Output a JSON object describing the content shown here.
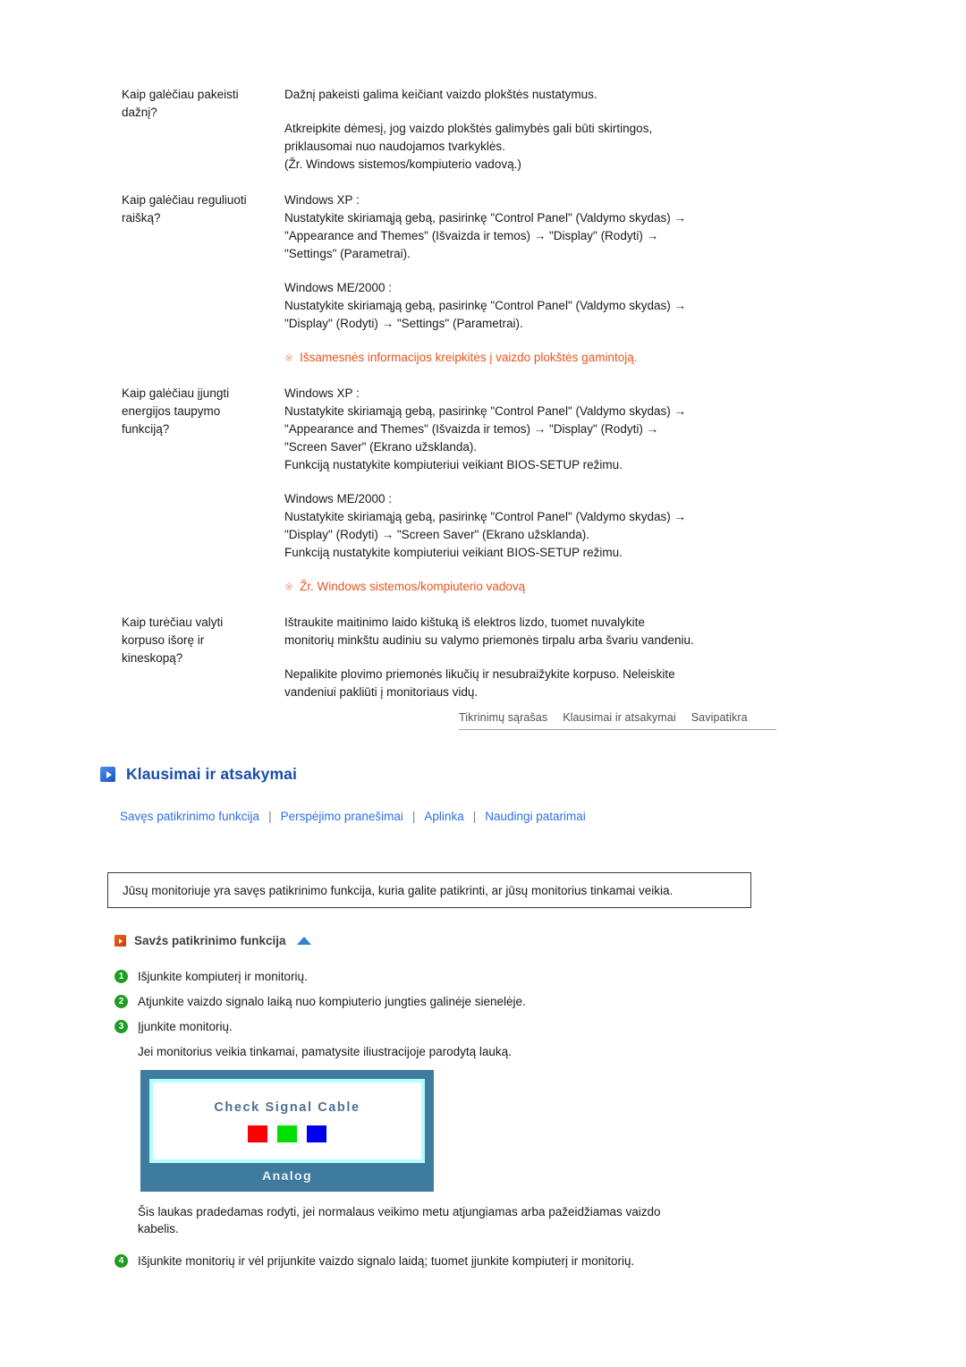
{
  "faq": {
    "rows": [
      {
        "question": [
          "Kaip galėčiau pakeisti",
          "dažnį?"
        ],
        "answer_blocks": [
          {
            "type": "para",
            "lines": [
              "Dažnį pakeisti galima keičiant vaizdo plokštės nustatymus."
            ]
          },
          {
            "type": "para",
            "lines": [
              "Atkreipkite dėmesį, jog vaizdo plokštės galimybės gali būti skirtingos,",
              "priklausomai nuo naudojamos tvarkyklės.",
              "(Žr. Windows sistemos/kompiuterio vadovą.)"
            ]
          }
        ]
      },
      {
        "question": [
          "Kaip galėčiau reguliuoti",
          "raišką?"
        ],
        "answer_blocks": [
          {
            "type": "para",
            "lines": [
              "Windows XP :",
              "Nustatykite skiriamąją gebą, pasirinkę \"Control Panel\" (Valdymo skydas) →",
              "\"Appearance and Themes\" (Išvaizda ir temos) → \"Display\" (Rodyti) →",
              "\"Settings\" (Parametrai)."
            ]
          },
          {
            "type": "para",
            "lines": [
              "Windows ME/2000 :",
              "Nustatykite skiriamąją gebą, pasirinkę \"Control Panel\" (Valdymo skydas) →",
              "\"Display\" (Rodyti) → \"Settings\" (Parametrai)."
            ]
          },
          {
            "type": "notice",
            "mark": "※",
            "text": "Išsamesnės informacijos kreipkitės į vaizdo plokštės gamintoją."
          }
        ]
      },
      {
        "question": [
          "Kaip galėčiau įjungti",
          "energijos taupymo",
          "funkciją?"
        ],
        "answer_blocks": [
          {
            "type": "para",
            "lines": [
              "Windows XP :",
              "Nustatykite skiriamąją gebą, pasirinkę \"Control Panel\" (Valdymo skydas) →",
              "\"Appearance and Themes\" (Išvaizda ir temos) → \"Display\" (Rodyti) →",
              "\"Screen Saver\" (Ekrano užsklanda).",
              "Funkciją nustatykite kompiuteriui veikiant BIOS-SETUP režimu."
            ]
          },
          {
            "type": "para",
            "lines": [
              "Windows ME/2000 :",
              "Nustatykite skiriamąją gebą, pasirinkę \"Control Panel\" (Valdymo skydas) →",
              "\"Display\" (Rodyti) → \"Screen Saver\" (Ekrano užsklanda).",
              "Funkciją nustatykite kompiuteriui veikiant BIOS-SETUP režimu."
            ]
          },
          {
            "type": "notice",
            "mark": "※",
            "text": "Žr. Windows sistemos/kompiuterio vadovą"
          }
        ]
      },
      {
        "question": [
          "Kaip turėčiau valyti",
          "korpuso išorę ir",
          "kineskopą?"
        ],
        "answer_blocks": [
          {
            "type": "para",
            "lines": [
              "Ištraukite maitinimo laido kištuką iš elektros lizdo, tuomet nuvalykite",
              "monitorių minkštu audiniu su valymo priemonės tirpalu arba švariu vandeniu."
            ]
          },
          {
            "type": "para",
            "lines": [
              "Nepalikite plovimo priemonės likučių ir nesubraižykite korpuso. Neleiskite",
              "vandeniui pakliūti į monitoriaus vidų."
            ]
          }
        ]
      }
    ]
  },
  "tabnav": {
    "items": [
      {
        "label": "Tikrinimų sąrašas"
      },
      {
        "label": "Klausimai ir atsakymai"
      },
      {
        "label": "Savipatikra"
      }
    ]
  },
  "section": {
    "title": "Klausimai ir atsakymai",
    "icon": "blue-play-square-icon"
  },
  "links": {
    "separator": "|",
    "items": [
      {
        "label": "Savęs patikrinimo funkcija"
      },
      {
        "label": "Perspėjimo pranešimai"
      },
      {
        "label": "Aplinka"
      },
      {
        "label": "Naudingi patarimai"
      }
    ]
  },
  "infobox": {
    "text": "Jūsų monitoriuje yra savęs patikrinimo funkcija, kuria galite patikrinti, ar jūsų monitorius tinkamai veikia."
  },
  "subheading": {
    "title": "Savźs patikrinimo funkcija",
    "icon": "orange-play-square-icon",
    "arrow": "blue-up-arrow-icon"
  },
  "steps": {
    "items": [
      {
        "num": "1",
        "text": "Išjunkite kompiuterį ir monitorių."
      },
      {
        "num": "2",
        "text": "Atjunkite vaizdo signalo laiką nuo kompiuterio jungties galinėje sienelėje."
      },
      {
        "num": "3",
        "text": "Įjunkite monitorių."
      }
    ],
    "note": "Jei monitorius veikia tinkamai, pamatysite iliustracijoje parodytą lauką."
  },
  "monitor": {
    "screen_title": "Check Signal Cable",
    "label": "Analog",
    "swatches": [
      "#fe0000",
      "#00e000",
      "#0000f0"
    ],
    "frame_color": "#3f7b9e",
    "inner_border_color": "#b4fdfb"
  },
  "footer": {
    "note_lines": [
      "Šis laukas pradedamas rodyti, jei normalaus veikimo metu atjungiamas arba pažeidžiamas vaizdo",
      "kabelis."
    ],
    "step": {
      "num": "4",
      "text": "Išjunkite monitorių ir vėl prijunkite vaizdo signalo laidą; tuomet įjunkite kompiuterį ir monitorių."
    }
  }
}
